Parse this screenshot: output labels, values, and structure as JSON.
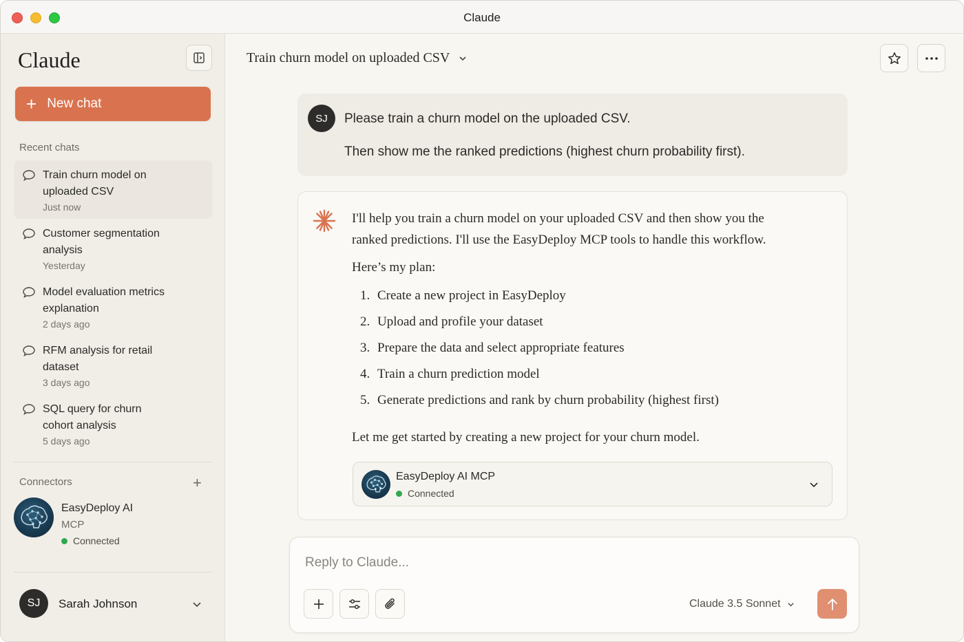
{
  "window": {
    "title": "Claude"
  },
  "sidebar": {
    "brand": "Claude",
    "new_chat_label": "New chat",
    "recent_label": "Recent chats",
    "chats": [
      {
        "title": "Train churn model on uploaded CSV",
        "time": "Just now",
        "active": true
      },
      {
        "title": "Customer segmentation analysis",
        "time": "Yesterday",
        "active": false
      },
      {
        "title": "Model evaluation metrics explanation",
        "time": "2 days ago",
        "active": false
      },
      {
        "title": "RFM analysis for retail dataset",
        "time": "3 days ago",
        "active": false
      },
      {
        "title": "SQL query for churn cohort analysis",
        "time": "5 days ago",
        "active": false
      }
    ],
    "connectors_label": "Connectors",
    "connector": {
      "name_line1": "EasyDeploy AI",
      "name_line2": "MCP",
      "status": "Connected"
    },
    "user": {
      "initials": "SJ",
      "name": "Sarah Johnson"
    }
  },
  "main": {
    "conversation_title": "Train churn model on uploaded CSV",
    "user_message": {
      "initials": "SJ",
      "line1": "Please train a churn model on the uploaded CSV.",
      "line2": "Then show me the ranked predictions (highest churn probability first)."
    },
    "ai_message": {
      "intro_line1": "I'll help you train a churn model on your uploaded CSV and then show you the",
      "intro_line2": "ranked predictions. I'll use the EasyDeploy MCP tools to handle this workflow.",
      "plan_heading": "Here’s my plan:",
      "plan_items": [
        "Create a new project in EasyDeploy",
        "Upload and profile your dataset",
        "Prepare the data and select appropriate features",
        "Train a churn prediction model",
        "Generate predictions and rank by churn probability (highest first)"
      ],
      "closing": "Let me get started by creating a new project for your churn model.",
      "tool_card": {
        "name": "EasyDeploy AI MCP",
        "status": "Connected"
      }
    },
    "composer": {
      "placeholder": "Reply to Claude...",
      "model": "Claude 3.5 Sonnet"
    }
  },
  "colors": {
    "accent": "#d9734f",
    "send_button": "#e08f71",
    "status_green": "#2fa84f"
  },
  "icons": [
    "panel-toggle-icon",
    "plus-icon",
    "chat-bubble-icon",
    "chevron-down-icon",
    "star-icon",
    "more-icon",
    "claude-spark-icon",
    "sliders-icon",
    "paperclip-icon",
    "arrow-up-icon"
  ]
}
